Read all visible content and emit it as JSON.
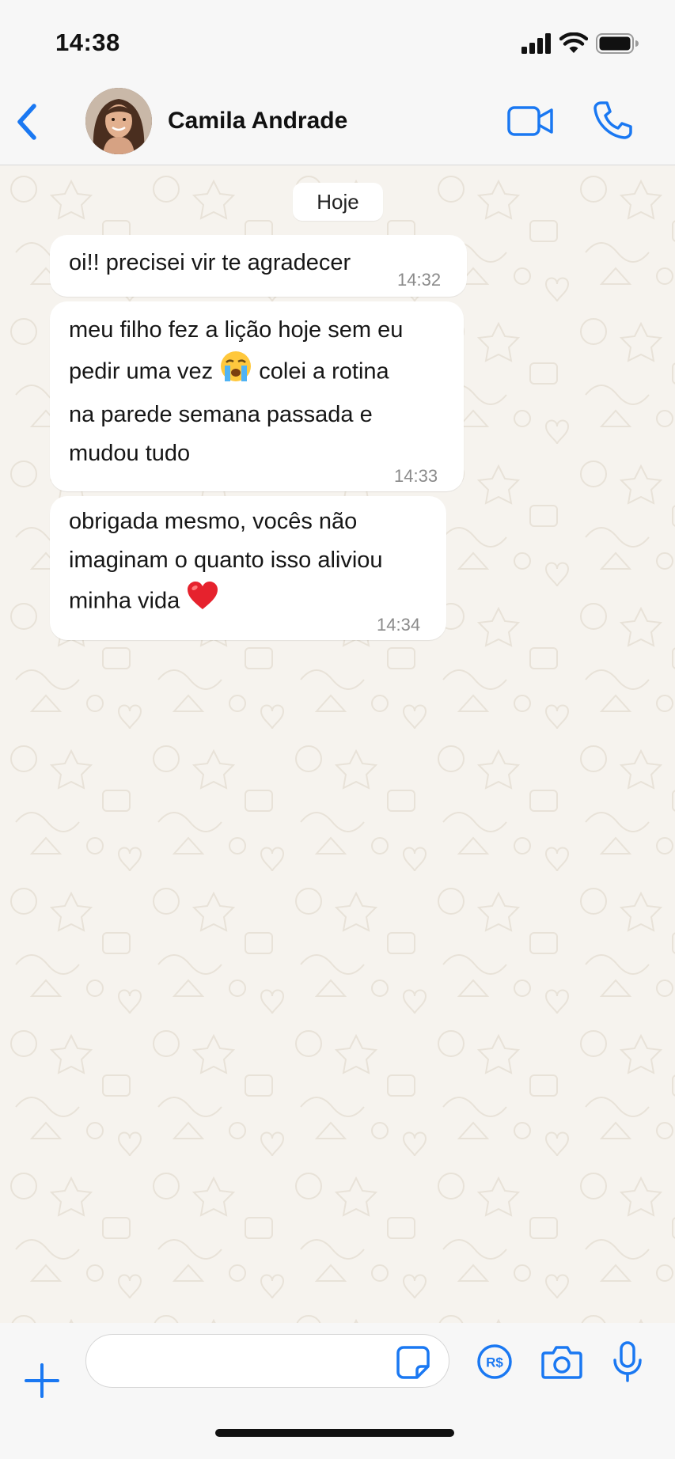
{
  "status_bar": {
    "time": "14:38"
  },
  "header": {
    "contact_name": "Camila Andrade"
  },
  "chat": {
    "date_label": "Hoje",
    "messages": [
      {
        "text": "oi!! precisei vir te agradecer",
        "time": "14:32"
      },
      {
        "text_before_emoji": "meu filho fez a lição hoje sem eu\npedir uma vez ",
        "emoji": "loudly-crying-face",
        "text_after_emoji": " colei a rotina\nna parede semana passada e\nmudou tudo",
        "time": "14:33"
      },
      {
        "text_before_emoji": "obrigada mesmo, vocês não\nimaginam o quanto isso aliviou\nminha vida ",
        "emoji": "red-heart",
        "time": "14:34"
      }
    ]
  },
  "composer": {
    "input_value": "",
    "placeholder": ""
  },
  "colors": {
    "accent": "#1a78f2",
    "bubble": "#ffffff",
    "wallpaper": "#f6f3ee"
  }
}
